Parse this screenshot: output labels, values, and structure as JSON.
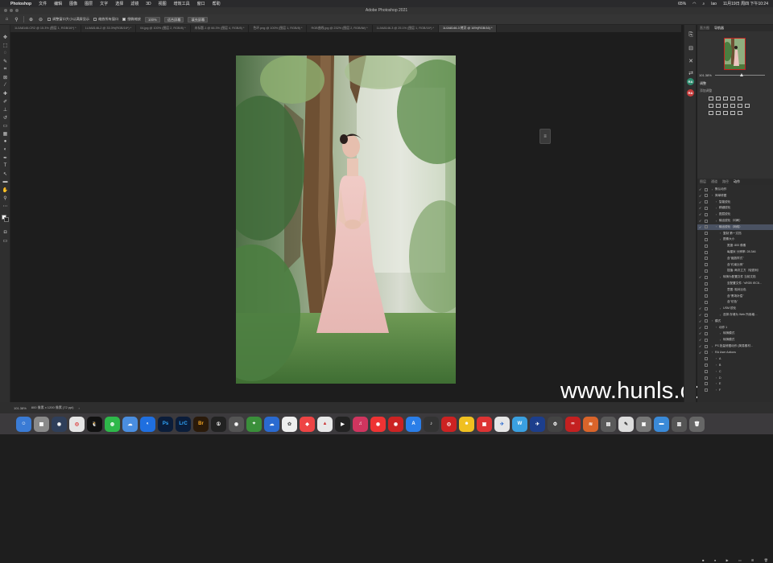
{
  "menubar": {
    "app": "Photoshop",
    "items": [
      "文件",
      "编辑",
      "图像",
      "图层",
      "文字",
      "选择",
      "滤镜",
      "3D",
      "视图",
      "增效工具",
      "窗口",
      "帮助"
    ],
    "right": [
      "65%",
      "lao",
      "11月19日 周四 下午10:24"
    ]
  },
  "window": {
    "title": "Adobe Photoshop 2021"
  },
  "options": {
    "checkbox1": "调整窗口大小以满屏显示",
    "checkbox2": "缩放所有窗口",
    "checkbox3": "细微缩放",
    "zoom_btn": "100%",
    "fit_btn": "适合屏幕",
    "fill_btn": "填充屏幕"
  },
  "tabs": [
    "1L0A8146.CR2 @ 15.3% (图层 1, RGB/16*) *",
    "1L0A8146-2 @ 33.3%(RGB/16*) *",
    "04.jpg @ 100% (图层 2, RGB/8) *",
    "未标题-1 @ 66.3% (图层 4, RGB/8) *",
    "色环.png @ 100% (图层 1, RGB/8) *",
    "RGB曲线.jpg @ 232% (图层 2, RGB/8#) *",
    "1L0A8146-3 @ 25.1% (图层 1, RGB/16*) *",
    "1L0A8146-3 拷贝 @ 16%(RGB/16) *"
  ],
  "panels": {
    "top_tabs": [
      "直方图",
      "导航器"
    ],
    "nav_zoom": "101.38%",
    "adj_title": "调整",
    "adj_sub": "添加调整",
    "action_tabs": [
      "图层",
      "通道",
      "路径",
      "动作"
    ],
    "actions": [
      {
        "t": "默认动作",
        "lvl": 1,
        "ck": "✓"
      },
      {
        "t": "简单修图",
        "lvl": 1,
        "ck": "✓"
      },
      {
        "t": "智能锐化",
        "lvl": 2,
        "ck": "✓"
      },
      {
        "t": "精细锐化",
        "lvl": 2,
        "ck": "✓"
      },
      {
        "t": "图层锐化",
        "lvl": 2,
        "ck": "✓"
      },
      {
        "t": "输出锐化（印刷）",
        "lvl": 2,
        "ck": "✓"
      },
      {
        "t": "输出锐化（网络）",
        "lvl": 2,
        "ck": "✓",
        "sel": true
      },
      {
        "t": "复制 第一文档",
        "lvl": 3,
        "ck": ""
      },
      {
        "t": "图像大小",
        "lvl": 3,
        "ck": ""
      },
      {
        "t": "宽度: 800 像素",
        "lvl": 4,
        "ck": ""
      },
      {
        "t": "每厘米 分辨率: 28.346",
        "lvl": 4,
        "ck": ""
      },
      {
        "t": "含\"缩放样式\"",
        "lvl": 4,
        "ck": ""
      },
      {
        "t": "含\"约束比例\"",
        "lvl": 4,
        "ck": ""
      },
      {
        "t": "插值: 两次立方（较锐利）",
        "lvl": 4,
        "ck": ""
      },
      {
        "t": "转换为配置文件 当前文档",
        "lvl": 3,
        "ck": "✓"
      },
      {
        "t": "至配置文件: \"sRGB IEC6…",
        "lvl": 4,
        "ck": ""
      },
      {
        "t": "意图: 相对比色",
        "lvl": 4,
        "ck": ""
      },
      {
        "t": "含\"黑场补偿\"",
        "lvl": 4,
        "ck": ""
      },
      {
        "t": "含\"仿色\"",
        "lvl": 4,
        "ck": ""
      },
      {
        "t": "USM 锐化",
        "lvl": 3,
        "ck": "✓"
      },
      {
        "t": "选择 存储为 Web 所用格…",
        "lvl": 3,
        "ck": "✓"
      },
      {
        "t": "模式",
        "lvl": 1,
        "ck": "✓"
      },
      {
        "t": "动作 1",
        "lvl": 2,
        "ck": "✓"
      },
      {
        "t": "转换模式",
        "lvl": 3,
        "ck": "✓"
      },
      {
        "t": "转换模式",
        "lvl": 3,
        "ck": "✓"
      },
      {
        "t": "PS 批量修图动作 (简易素材…",
        "lvl": 1,
        "ck": "✓"
      },
      {
        "t": "RA User Actions",
        "lvl": 1,
        "ck": "✓"
      },
      {
        "t": "A",
        "lvl": 2,
        "ck": ""
      },
      {
        "t": "B",
        "lvl": 2,
        "ck": ""
      },
      {
        "t": "C",
        "lvl": 2,
        "ck": ""
      },
      {
        "t": "D",
        "lvl": 2,
        "ck": ""
      },
      {
        "t": "E",
        "lvl": 2,
        "ck": ""
      },
      {
        "t": "F",
        "lvl": 2,
        "ck": ""
      }
    ]
  },
  "status": {
    "zoom": "101.38%",
    "doc": "800 像素 x 1200 像素 (72 ppi)"
  },
  "watermark": "www.hunls.com",
  "dock_labels": {
    "ps": "Ps",
    "lrc": "LrC",
    "br": "Br"
  }
}
